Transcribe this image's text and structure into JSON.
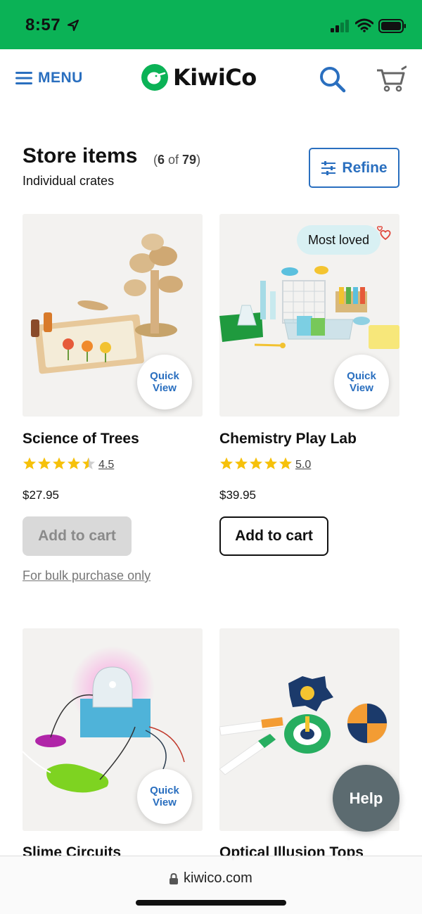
{
  "status_bar": {
    "time": "8:57"
  },
  "header": {
    "menu_label": "MENU",
    "logo_text": "KiwiCo"
  },
  "listing": {
    "title": "Store items",
    "count_prefix": "(",
    "count_shown": "6",
    "count_of": " of ",
    "count_total": "79",
    "count_suffix": ")",
    "subtitle": "Individual crates",
    "refine_label": "Refine"
  },
  "products": [
    {
      "name": "Science of Trees",
      "rating": "4.5",
      "stars": 4.5,
      "price": "$27.95",
      "cart_label": "Add to cart",
      "cart_enabled": false,
      "bulk_note": "For bulk purchase only",
      "quick_view": "Quick View"
    },
    {
      "name": "Chemistry Play Lab",
      "rating": "5.0",
      "stars": 5,
      "price": "$39.95",
      "cart_label": "Add to cart",
      "cart_enabled": true,
      "badge": "Most loved",
      "quick_view": "Quick View"
    },
    {
      "name": "Slime Circuits",
      "quick_view": "Quick View"
    },
    {
      "name": "Optical Illusion Tops"
    }
  ],
  "help_label": "Help",
  "browser": {
    "url": "kiwico.com"
  },
  "colors": {
    "status_green": "#0bb256",
    "brand_blue": "#2a6fbf",
    "star_yellow": "#f6c10a",
    "help_gray": "#5c6b70"
  },
  "icons": [
    "location-arrow-icon",
    "signal-icon",
    "wifi-icon",
    "battery-icon",
    "menu-icon",
    "kiwico-logo-icon",
    "search-icon",
    "cart-icon",
    "refine-sliders-icon",
    "star-icon",
    "heart-icon",
    "lock-icon"
  ]
}
